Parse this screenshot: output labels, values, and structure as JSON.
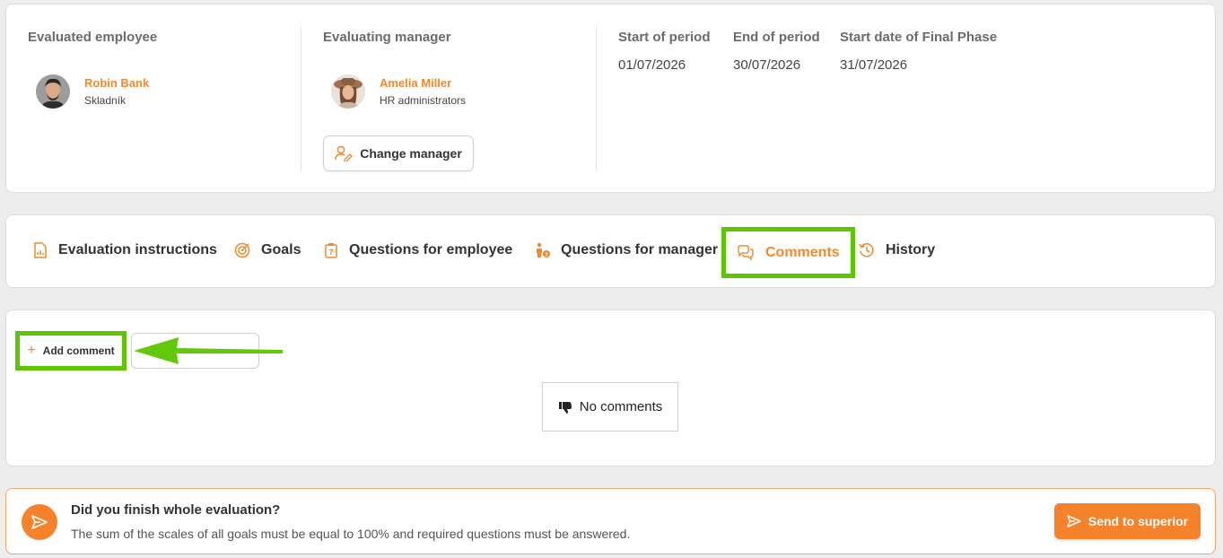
{
  "header": {
    "evaluated_employee_label": "Evaluated employee",
    "employee": {
      "name": "Robin Bank",
      "role": "Skladník"
    },
    "evaluating_manager_label": "Evaluating manager",
    "manager": {
      "name": "Amelia Miller",
      "role": "HR administrators"
    },
    "change_manager_label": "Change manager",
    "dates": [
      {
        "label": "Start of period",
        "value": "01/07/2026"
      },
      {
        "label": "End of period",
        "value": "30/07/2026"
      },
      {
        "label": "Start date of Final Phase",
        "value": "31/07/2026"
      }
    ]
  },
  "tabs": [
    {
      "label": "Evaluation instructions",
      "icon": "document-chart-icon"
    },
    {
      "label": "Goals",
      "icon": "target-icon"
    },
    {
      "label": "Questions for employee",
      "icon": "clipboard-question-icon"
    },
    {
      "label": "Questions for manager",
      "icon": "person-question-icon"
    },
    {
      "label": "Comments",
      "icon": "chat-bubbles-icon",
      "active": true
    },
    {
      "label": "History",
      "icon": "history-icon"
    }
  ],
  "comments": {
    "add_label": "Add comment",
    "empty_label": "No comments"
  },
  "footer": {
    "title": "Did you finish whole evaluation?",
    "text": "The sum of the scales of all goals must be equal to 100% and required questions must be answered.",
    "send_label": "Send to superior"
  },
  "colors": {
    "accent": "#f08a2c",
    "highlight": "#5ec600",
    "button": "#f7822c"
  }
}
